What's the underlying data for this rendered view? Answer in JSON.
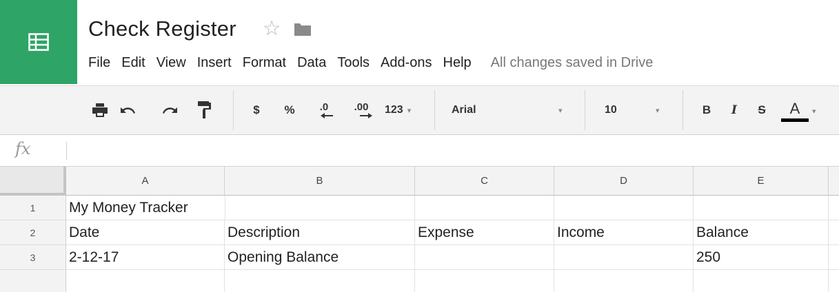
{
  "header": {
    "title": "Check Register",
    "menu": [
      {
        "id": "file",
        "label": "File"
      },
      {
        "id": "edit",
        "label": "Edit"
      },
      {
        "id": "view",
        "label": "View"
      },
      {
        "id": "insert",
        "label": "Insert"
      },
      {
        "id": "format",
        "label": "Format"
      },
      {
        "id": "data",
        "label": "Data"
      },
      {
        "id": "tools",
        "label": "Tools"
      },
      {
        "id": "addons",
        "label": "Add-ons"
      },
      {
        "id": "help",
        "label": "Help"
      }
    ],
    "save_status": "All changes saved in Drive"
  },
  "toolbar": {
    "currency_label": "$",
    "percent_label": "%",
    "decrease_decimal_label": ".0",
    "increase_decimal_label": ".00",
    "number_format_label": "123",
    "font_family": "Arial",
    "font_size": "10",
    "bold_label": "B",
    "italic_label": "I",
    "strike_label": "S",
    "text_color_label": "A",
    "text_color": "#000000"
  },
  "formula_bar": {
    "fx_label": "fx",
    "value": ""
  },
  "grid": {
    "columns": [
      "A",
      "B",
      "C",
      "D",
      "E"
    ],
    "rows": [
      {
        "number": "1",
        "cells": [
          "My Money Tracker",
          "",
          "",
          "",
          ""
        ]
      },
      {
        "number": "2",
        "cells": [
          "Date",
          "Description",
          "Expense",
          "Income",
          "Balance"
        ]
      },
      {
        "number": "3",
        "cells": [
          "2-12-17",
          "Opening Balance",
          "",
          "",
          "250"
        ]
      }
    ]
  },
  "colors": {
    "brand": "#2ea466",
    "toolbar_bg": "#f3f3f3",
    "header_bg": "#f3f3f3"
  }
}
